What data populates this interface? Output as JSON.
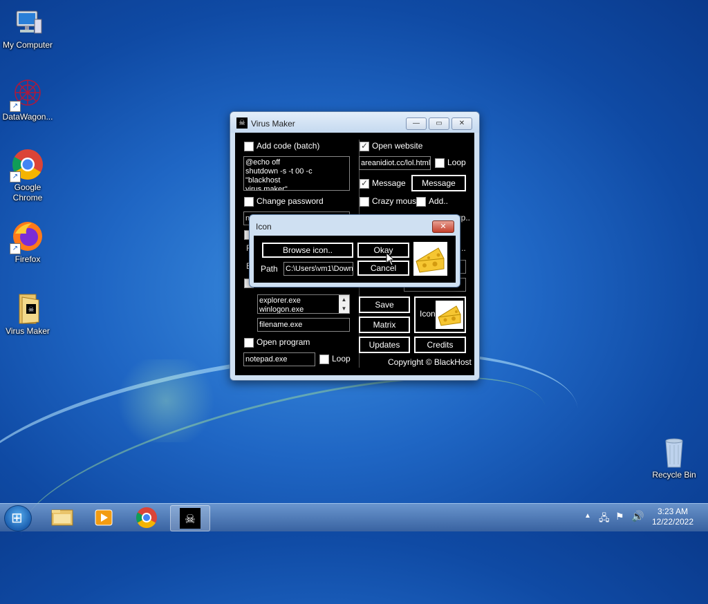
{
  "desktop": {
    "icons": [
      {
        "label": "My Computer",
        "icon": "computer-icon"
      },
      {
        "label": "DataWagon...",
        "icon": "datawagon-icon"
      },
      {
        "label": "Google Chrome",
        "icon": "chrome-icon"
      },
      {
        "label": "Firefox",
        "icon": "firefox-icon"
      },
      {
        "label": "Virus Maker",
        "icon": "virus-maker-folder-icon"
      },
      {
        "label": "Recycle Bin",
        "icon": "recycle-bin-icon"
      }
    ]
  },
  "main_window": {
    "title": "Virus Maker",
    "add_code": {
      "label": "Add code (batch)",
      "checked": false,
      "code": "@echo off\nshutdown -s -t 00 -c \"blackhost\nvirus maker\""
    },
    "change_password": {
      "label": "Change password",
      "checked": false,
      "value": "n"
    },
    "partial_letters": {
      "a": "F",
      "b": "E"
    },
    "processes": {
      "list": "explorer.exe\nwinlogon.exe",
      "filename": "filename.exe"
    },
    "open_program": {
      "label": "Open program",
      "checked": false,
      "value": "notepad.exe",
      "loop_label": "Loop"
    },
    "open_website": {
      "label": "Open website",
      "checked": true,
      "value": "areanidiot.cc/lol.html",
      "loop_label": "Loop"
    },
    "message": {
      "label": "Message",
      "checked": true,
      "button": "Message"
    },
    "crazy_mouse": {
      "label": "Crazy mouse",
      "checked": false
    },
    "add": {
      "label": "Add.."
    },
    "partial_up": "up..",
    "partial_dots": "..",
    "buttons": {
      "save": "Save",
      "matrix": "Matrix",
      "updates": "Updates",
      "credits": "Credits",
      "icon": "Icon"
    },
    "copyright": "Copyright © BlackHost"
  },
  "icon_dialog": {
    "title": "Icon",
    "browse": "Browse icon..",
    "okay": "Okay",
    "cancel": "Cancel",
    "path_label": "Path",
    "path_value": "C:\\Users\\vm1\\Down"
  },
  "taskbar": {
    "time": "3:23 AM",
    "date": "12/22/2022"
  },
  "colors": {
    "window_bg": "#000000",
    "frame": "#cfe0f2",
    "desktop": "#1f66c4"
  }
}
